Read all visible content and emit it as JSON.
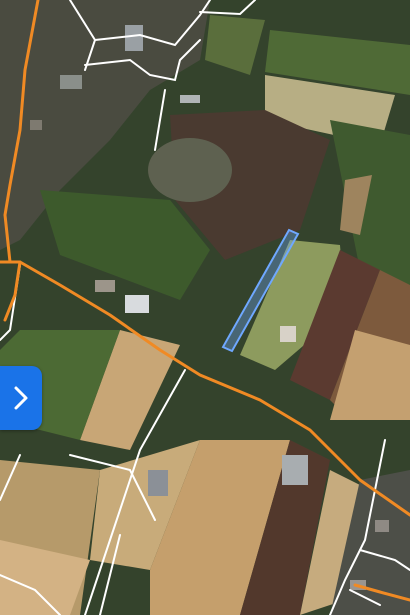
{
  "map": {
    "view": "satellite",
    "colors": {
      "main_road": "#f08a24",
      "minor_road": "#ffffff",
      "selection": "#6fa8ff",
      "button": "#1a73e8"
    }
  },
  "controls": {
    "expand_icon": "chevron-right-icon"
  }
}
